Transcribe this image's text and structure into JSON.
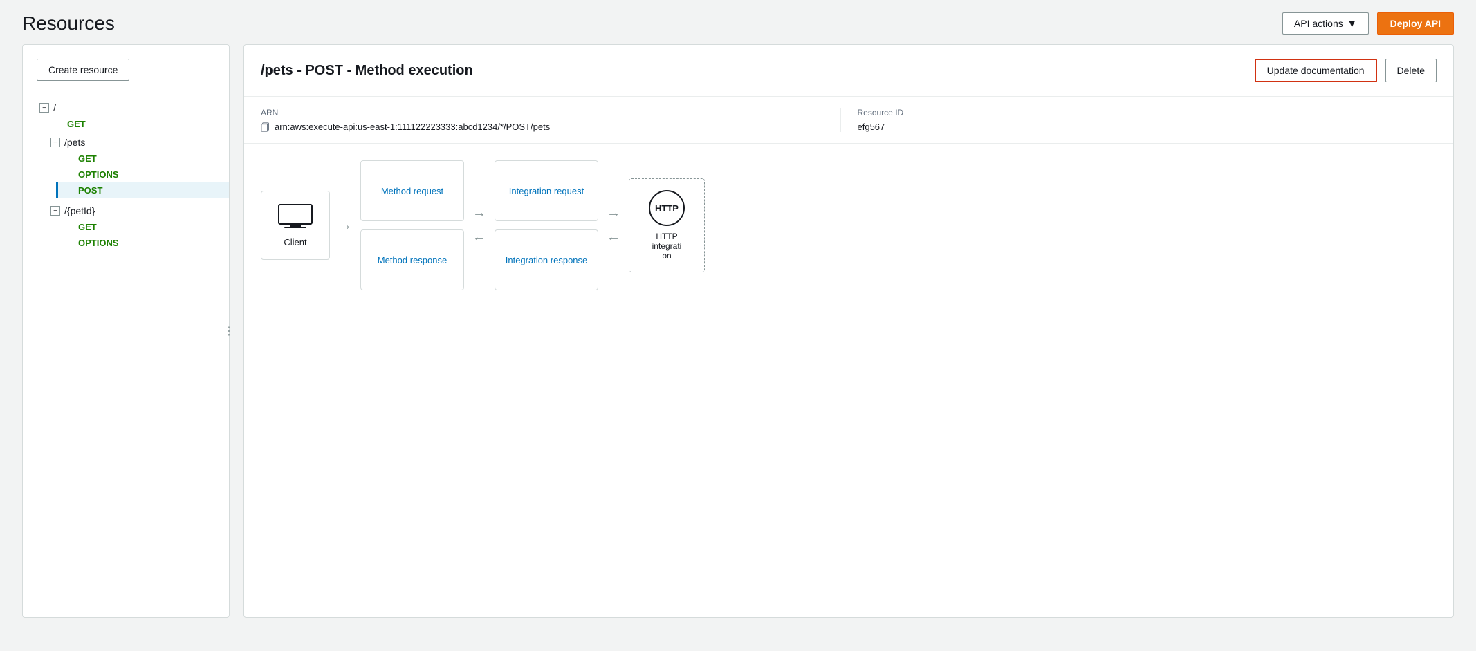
{
  "page": {
    "title": "Resources"
  },
  "header": {
    "api_actions_label": "API actions",
    "deploy_api_label": "Deploy API"
  },
  "left_panel": {
    "create_resource_label": "Create resource",
    "tree": [
      {
        "id": "root",
        "name": "/",
        "expanded": true,
        "children": [
          {
            "id": "root-get",
            "method": "GET",
            "type": "method",
            "class": "get"
          },
          {
            "id": "pets",
            "name": "/pets",
            "expanded": true,
            "children": [
              {
                "id": "pets-get",
                "method": "GET",
                "type": "method",
                "class": "get"
              },
              {
                "id": "pets-options",
                "method": "OPTIONS",
                "type": "method",
                "class": "options"
              },
              {
                "id": "pets-post",
                "method": "POST",
                "type": "method",
                "class": "post active"
              }
            ]
          },
          {
            "id": "petId",
            "name": "/{petId}",
            "expanded": true,
            "children": [
              {
                "id": "petId-get",
                "method": "GET",
                "type": "method",
                "class": "get"
              },
              {
                "id": "petId-options",
                "method": "OPTIONS",
                "type": "method",
                "class": "options"
              }
            ]
          }
        ]
      }
    ]
  },
  "right_panel": {
    "method_title": "/pets - POST - Method execution",
    "update_doc_label": "Update documentation",
    "delete_label": "Delete",
    "arn_label": "ARN",
    "arn_value": "arn:aws:execute-api:us-east-1:111122223333:abcd1234/*/POST/pets",
    "resource_id_label": "Resource ID",
    "resource_id_value": "efg567",
    "flow": {
      "client_label": "Client",
      "method_request_label": "Method request",
      "integration_request_label": "Integration request",
      "method_response_label": "Method response",
      "integration_response_label": "Integration response",
      "http_label": "HTTP",
      "http_integration_label": "HTTP integration"
    }
  }
}
